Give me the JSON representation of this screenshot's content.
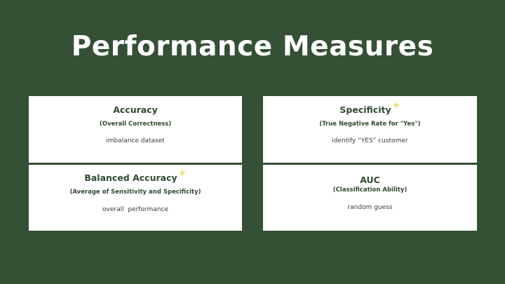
{
  "slide": {
    "title": "Performance Measures"
  },
  "cards": [
    {
      "title": "Accuracy",
      "subtitle": "(Overall Correctness)",
      "note": "imbalance dataset",
      "starred": false
    },
    {
      "title": "Specificity",
      "subtitle": "(True Negative Rate for \"Yes\")",
      "note": "identify “YES” customer",
      "starred": true
    },
    {
      "title": "Balanced Accuracy",
      "subtitle": "(Average of Sensitivity and Specificity)",
      "note": "overall  performance",
      "starred": true
    },
    {
      "title": "AUC",
      "subtitle": "(Classification Ability)",
      "note": "random guess",
      "starred": false
    }
  ],
  "colors": {
    "background": "#345035",
    "card": "#ffffff",
    "heading": "#2f4a30",
    "star": "#f3dc6a"
  },
  "icons": {
    "star": "sparkle-star-icon"
  }
}
